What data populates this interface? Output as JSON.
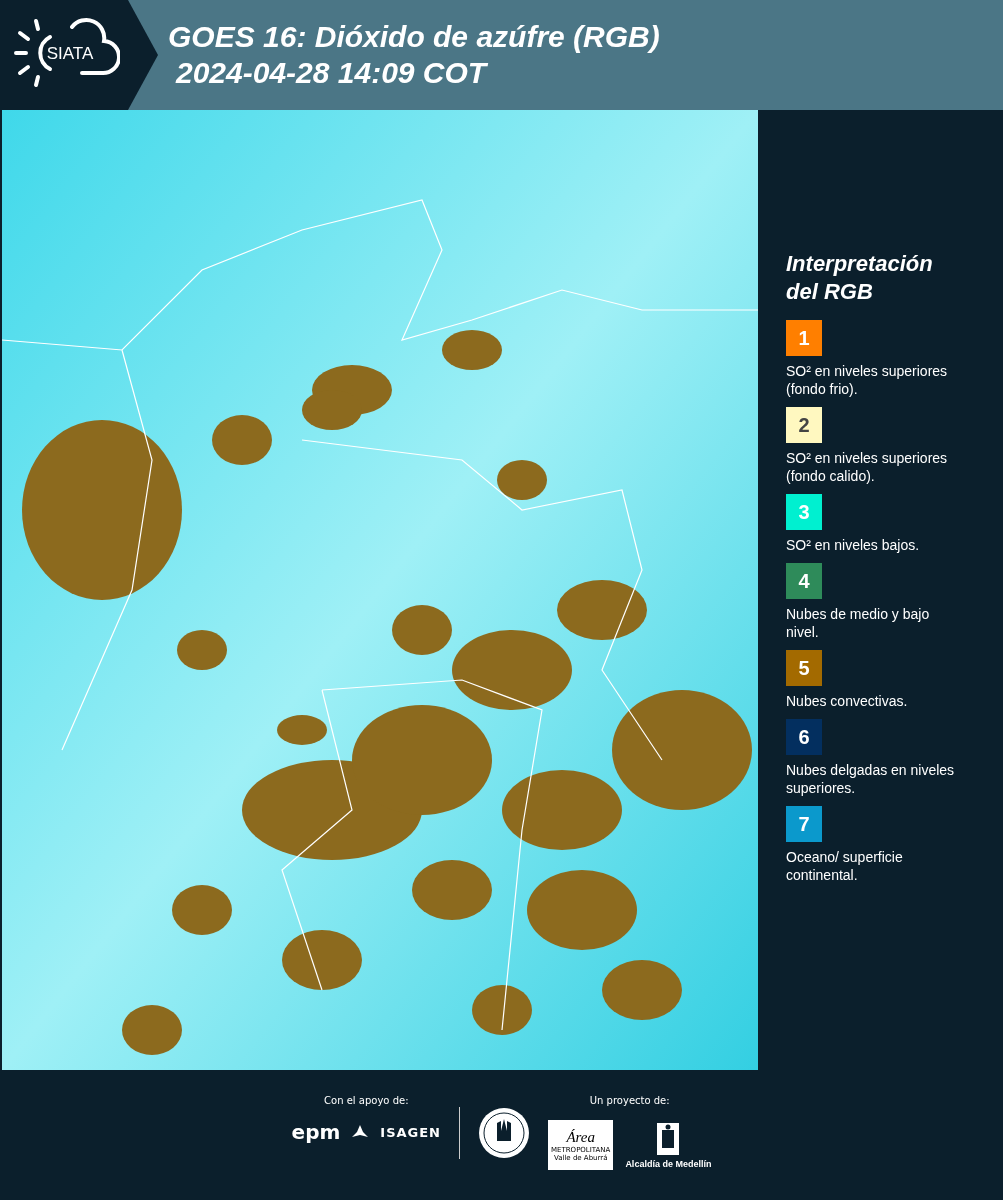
{
  "header": {
    "logo": "SIATA",
    "title": "GOES 16: Dióxido de azúfre (RGB)",
    "timestamp": "2024-04-28 14:09 COT"
  },
  "legend": {
    "title_lines": [
      "Interpretación",
      "del RGB"
    ],
    "items": [
      {
        "number": "1",
        "color": "#ff7f00",
        "text": "SO² en niveles superiores (fondo frio)."
      },
      {
        "number": "2",
        "color": "#fff8c0",
        "text": "SO² en niveles superiores (fondo calido)."
      },
      {
        "number": "3",
        "color": "#00f0d0",
        "text": "SO² en niveles bajos."
      },
      {
        "number": "4",
        "color": "#2e8b5a",
        "text": "Nubes de medio y bajo nivel."
      },
      {
        "number": "5",
        "color": "#a36a00",
        "text": "Nubes convectivas."
      },
      {
        "number": "6",
        "color": "#032f5f",
        "text": "Nubes delgadas en niveles superiores."
      },
      {
        "number": "7",
        "color": "#0b99cc",
        "text": "Oceano/ superficie continental."
      }
    ]
  },
  "footer": {
    "support_label": "Con el apoyo de:",
    "project_label": "Un proyecto de:",
    "epm": "epm",
    "isagen": "ISAGEN",
    "area": "Área",
    "area_sub": "METROPOLITANA",
    "area_sub2": "Valle de Aburrá",
    "alcaldia": "Alcaldía de Medellín"
  }
}
